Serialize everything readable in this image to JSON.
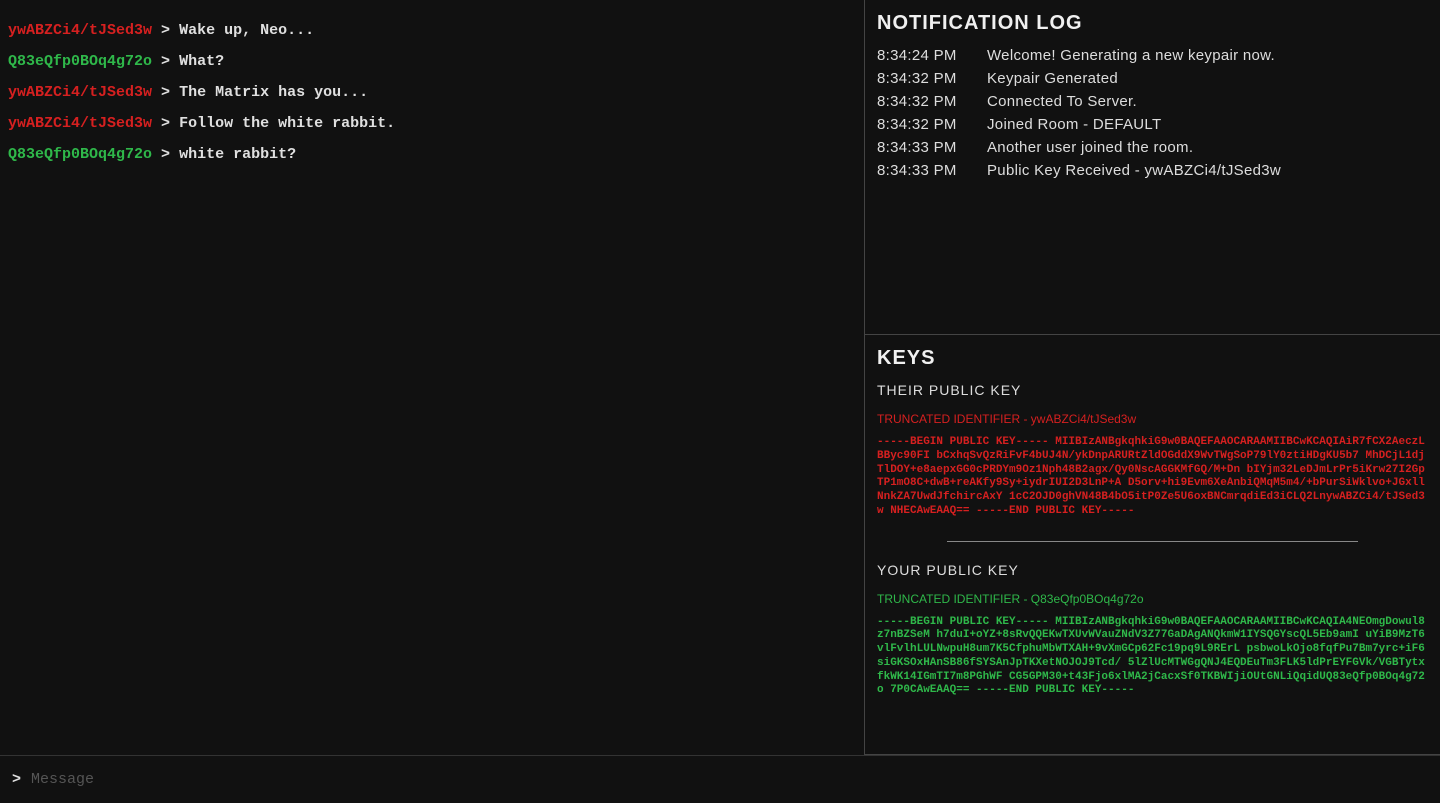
{
  "chat": {
    "user_red_id": "ywABZCi4/tJSed3w",
    "user_green_id": "Q83eQfp0BOq4g72o",
    "lines": [
      {
        "who": "red",
        "text": "Wake up, Neo..."
      },
      {
        "who": "green",
        "text": "What?"
      },
      {
        "who": "red",
        "text": "The Matrix has you..."
      },
      {
        "who": "red",
        "text": "Follow the white rabbit."
      },
      {
        "who": "green",
        "text": "white rabbit?"
      }
    ]
  },
  "input": {
    "prompt": ">",
    "placeholder": "Message"
  },
  "notification": {
    "title": "NOTIFICATION LOG",
    "rows": [
      {
        "time": "8:34:24 PM",
        "msg": "Welcome! Generating a new keypair now."
      },
      {
        "time": "8:34:32 PM",
        "msg": "Keypair Generated"
      },
      {
        "time": "8:34:32 PM",
        "msg": "Connected To Server."
      },
      {
        "time": "8:34:32 PM",
        "msg": "Joined Room - DEFAULT"
      },
      {
        "time": "8:34:33 PM",
        "msg": "Another user joined the room."
      },
      {
        "time": "8:34:33 PM",
        "msg": "Public Key Received - ywABZCi4/tJSed3w"
      }
    ]
  },
  "keys": {
    "title": "KEYS",
    "their": {
      "label": "THEIR PUBLIC KEY",
      "trunc_label": "TRUNCATED IDENTIFIER - ywABZCi4/tJSed3w",
      "pem": "-----BEGIN PUBLIC KEY-----  MIIBIzANBgkqhkiG9w0BAQEFAAOCARAAMIIBCwKCAQIAiR7fCX2AeczLBByc90FI bCxhqSvQzRiFvF4bUJ4N/ykDnpARURtZldOGddX9WvTWgSoP79lY0ztiHDgKU5b7 MhDCjL1djTlDOY+e8aepxGG0cPRDYm9Oz1Nph48B2agx/Qy0NscAGGKMfGQ/M+Dn bIYjm32LeDJmLrPr5iKrw27I2GpTP1mO8C+dwB+reAKfy9Sy+iydrIUI2D3LnP+A D5orv+hi9Evm6XeAnbiQMqM5m4/+bPurSiWklvo+JGxllNnkZA7UwdJfchircAxY 1cC2OJD0ghVN48B4bO5itP0Ze5U6oxBNCmrqdiEd3iCLQ2LnywABZCi4/tJSed3w NHECAwEAAQ== -----END PUBLIC KEY-----"
    },
    "your": {
      "label": "YOUR PUBLIC KEY",
      "trunc_label": "TRUNCATED IDENTIFIER - Q83eQfp0BOq4g72o",
      "pem": "-----BEGIN PUBLIC KEY-----  MIIBIzANBgkqhkiG9w0BAQEFAAOCARAAMIIBCwKCAQIA4NEOmgDowul8z7nBZSeM h7duI+oYZ+8sRvQQEKwTXUvWVauZNdV3Z77GaDAgANQkmW1IYSQGYscQL5Eb9amI uYiB9MzT6vlFvlhLULNwpuH8um7K5CfphuMbWTXAH+9vXmGCp62Fc19pq9L9RErL psbwoLkOjo8fqfPu7Bm7yrc+iF6siGKSOxHAnSB86fSYSAnJpTKXetNOJOJ9Tcd/ 5lZlUcMTWGgQNJ4EQDEuTm3FLK5ldPrEYFGVk/VGBTytxfkWK14IGmTI7m8PGhWF CG5GPM30+t43Fjo6xlMA2jCacxSf0TKBWIjiOUtGNLiQqidUQ83eQfp0BOq4g72o 7P0CAwEAAQ== -----END PUBLIC KEY-----"
    }
  }
}
